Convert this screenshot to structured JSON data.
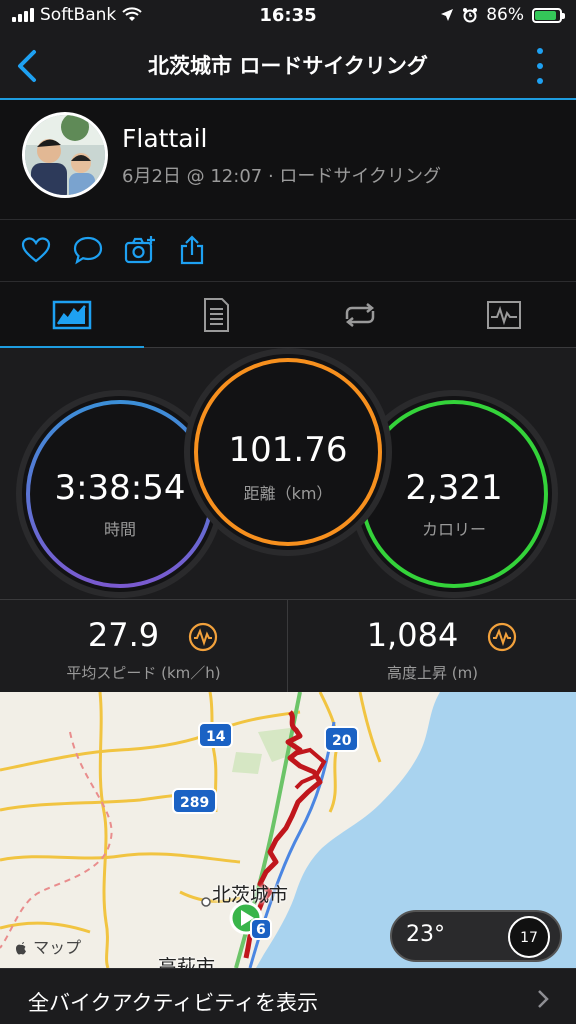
{
  "status_bar": {
    "carrier": "SoftBank",
    "time": "16:35",
    "battery": "86%",
    "battery_level": 0.86
  },
  "header": {
    "title": "北茨城市 ロードサイクリング"
  },
  "profile": {
    "name": "Flattail",
    "meta": "6月2日 @ 12:07 · ロードサイクリング"
  },
  "actions": [
    "heart-icon",
    "comment-icon",
    "camera-add-icon",
    "share-icon"
  ],
  "tabs": [
    {
      "name": "summary",
      "icon": "stats-chart-icon",
      "active": true
    },
    {
      "name": "details",
      "icon": "document-list-icon",
      "active": false
    },
    {
      "name": "laps",
      "icon": "loop-icon",
      "active": false
    },
    {
      "name": "charts",
      "icon": "graph-icon",
      "active": false
    }
  ],
  "stats": {
    "time": {
      "value": "3:38:54",
      "label": "時間"
    },
    "distance": {
      "value": "101.76",
      "label": "距離（km）"
    },
    "calories": {
      "value": "2,321",
      "label": "カロリー"
    }
  },
  "metrics": {
    "speed": {
      "value": "27.9",
      "label": "平均スピード (km／h)"
    },
    "ascent": {
      "value": "1,084",
      "label": "高度上昇 (m)"
    }
  },
  "map": {
    "labels": {
      "city1": "北茨城市",
      "city2": "高萩市"
    },
    "route_numbers": {
      "r14": "14",
      "r20": "20",
      "r289": "289",
      "r6": "6"
    },
    "attribution": "マップ",
    "temperature": "23°",
    "wind": "17"
  },
  "footer": {
    "label": "全バイクアクティビティを表示"
  },
  "colors": {
    "accent": "#1e9de0",
    "time_ring": "#4d7ed6",
    "distance_ring": "#f7901e",
    "calories_ring": "#3ad43a",
    "route": "#c0161c"
  }
}
